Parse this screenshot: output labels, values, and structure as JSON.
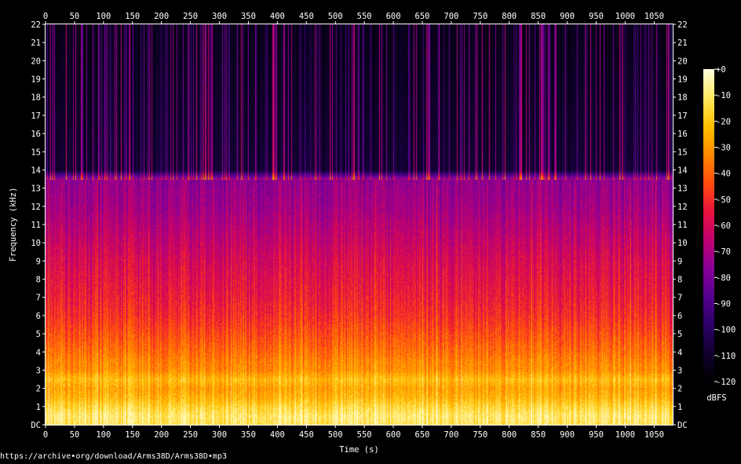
{
  "chart_data": {
    "type": "heatmap",
    "title": "",
    "xlabel": "Time (s)",
    "ylabel": "Frequency (kHz)",
    "xlim": [
      0,
      1082
    ],
    "ylim": [
      0,
      22
    ],
    "x_ticks": [
      "0",
      "50",
      "100",
      "150",
      "200",
      "250",
      "300",
      "350",
      "400",
      "450",
      "500",
      "550",
      "600",
      "650",
      "700",
      "750",
      "800",
      "850",
      "900",
      "950",
      "1000",
      "1050"
    ],
    "y_ticks": [
      "DC",
      "1",
      "2",
      "3",
      "4",
      "5",
      "6",
      "7",
      "8",
      "9",
      "10",
      "11",
      "12",
      "13",
      "14",
      "15",
      "16",
      "17",
      "18",
      "19",
      "20",
      "21",
      "22"
    ],
    "lowpass_cutoff_khz": 13.5,
    "colorbar": {
      "label": "dBFS",
      "range": [
        -120,
        0
      ],
      "ticks": [
        "+0",
        "-10",
        "-20",
        "-30",
        "-40",
        "-50",
        "-60",
        "-70",
        "-80",
        "-90",
        "-100",
        "-110",
        "-120"
      ],
      "colors": [
        "#000000",
        "#10002e",
        "#2c0066",
        "#55008e",
        "#8a0098",
        "#c00070",
        "#e8143c",
        "#ff4d0e",
        "#ff8a00",
        "#ffc000",
        "#ffe860",
        "#ffffe0"
      ]
    },
    "spectral_profile": {
      "freq_khz": [
        0,
        0.5,
        1,
        1.5,
        2,
        2.5,
        3,
        3.5,
        4,
        5,
        6,
        7,
        8,
        9,
        10,
        11,
        12,
        13,
        13.5,
        14,
        22
      ],
      "dbfs": [
        -12,
        -10,
        -16,
        -24,
        -28,
        -22,
        -32,
        -34,
        -38,
        -44,
        -50,
        -54,
        -57,
        -60,
        -64,
        -68,
        -72,
        -74,
        -76,
        -112,
        -118
      ]
    },
    "grid": false
  },
  "footer": {
    "source_url": "https://archive•org/download/Arms38D/Arms38D•mp3"
  }
}
